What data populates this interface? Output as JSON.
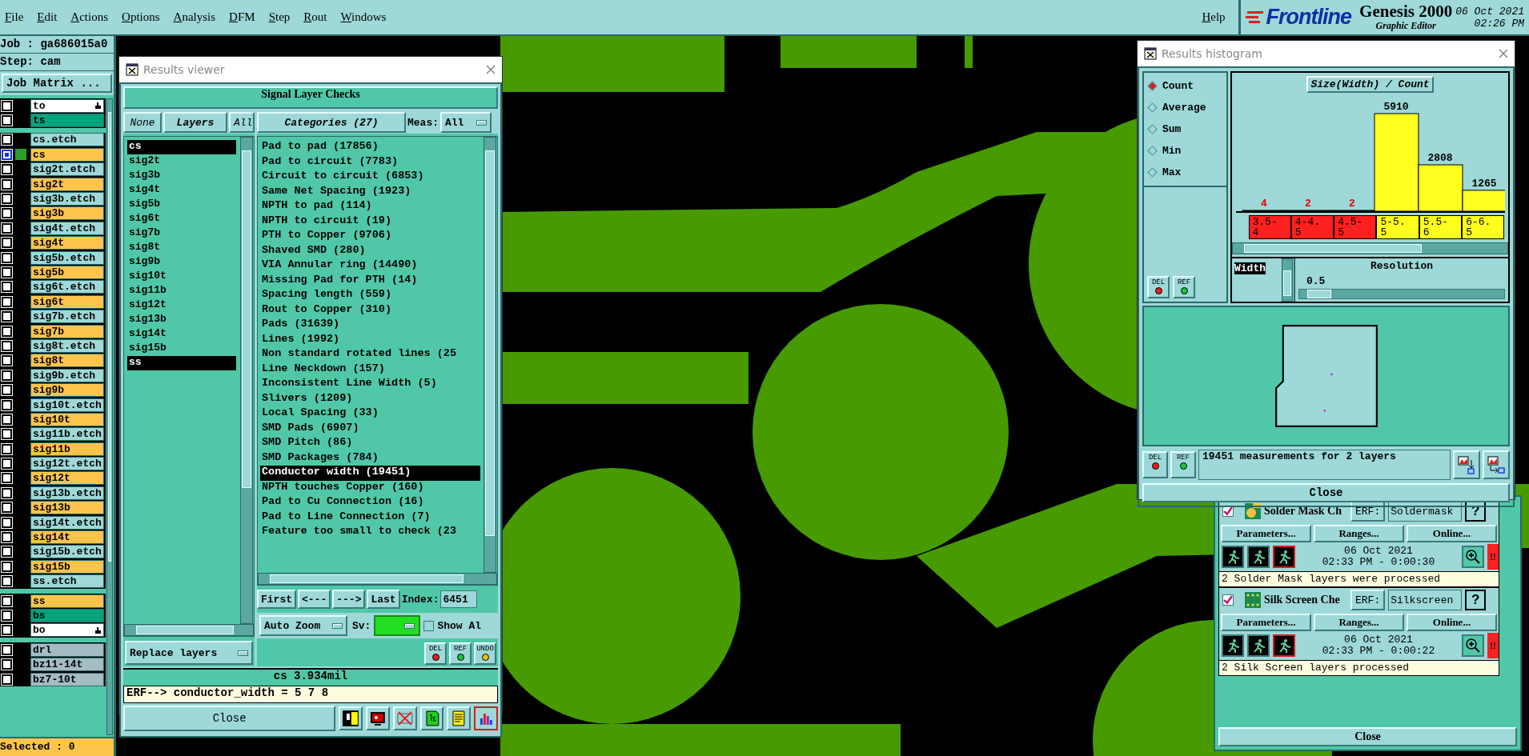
{
  "menu_bar": {
    "items": [
      "File",
      "Edit",
      "Actions",
      "Options",
      "Analysis",
      "DFM",
      "Step",
      "Rout",
      "Windows"
    ],
    "help": "Help",
    "logo": "Frontline",
    "product": "Genesis 2000",
    "subtitle": "Graphic Editor",
    "date": "06 Oct 2021",
    "time": "02:26 PM"
  },
  "job_panel": {
    "job": "Job : ga686015a0",
    "step": "Step: cam",
    "matrix_button": "Job Matrix ...",
    "selected_count": "Selected : 0",
    "layer_groups": [
      {
        "layers": [
          {
            "name": "to",
            "color": "#ffffff",
            "kind": "hand",
            "selected": false
          },
          {
            "name": "ts",
            "color": "#00a47c",
            "kind": "plain",
            "selected": false
          }
        ]
      },
      {
        "layers": [
          {
            "name": "cs.etch",
            "color": "#9ed8d8",
            "kind": "plain",
            "selected": false
          },
          {
            "name": "cs",
            "color": "#ffc44c",
            "kind": "plain",
            "selected": true
          },
          {
            "name": "sig2t.etch",
            "color": "#9ed8d8",
            "kind": "plain",
            "selected": false
          },
          {
            "name": "sig2t",
            "color": "#ffc44c",
            "kind": "plain",
            "selected": false
          },
          {
            "name": "sig3b.etch",
            "color": "#9ed8d8",
            "kind": "plain",
            "selected": false
          },
          {
            "name": "sig3b",
            "color": "#ffc44c",
            "kind": "plain",
            "selected": false
          },
          {
            "name": "sig4t.etch",
            "color": "#9ed8d8",
            "kind": "plain",
            "selected": false
          },
          {
            "name": "sig4t",
            "color": "#ffc44c",
            "kind": "plain",
            "selected": false
          },
          {
            "name": "sig5b.etch",
            "color": "#9ed8d8",
            "kind": "plain",
            "selected": false
          },
          {
            "name": "sig5b",
            "color": "#ffc44c",
            "kind": "plain",
            "selected": false
          },
          {
            "name": "sig6t.etch",
            "color": "#9ed8d8",
            "kind": "plain",
            "selected": false
          },
          {
            "name": "sig6t",
            "color": "#ffc44c",
            "kind": "plain",
            "selected": false
          },
          {
            "name": "sig7b.etch",
            "color": "#9ed8d8",
            "kind": "plain",
            "selected": false
          },
          {
            "name": "sig7b",
            "color": "#ffc44c",
            "kind": "plain",
            "selected": false
          },
          {
            "name": "sig8t.etch",
            "color": "#9ed8d8",
            "kind": "plain",
            "selected": false
          },
          {
            "name": "sig8t",
            "color": "#ffc44c",
            "kind": "plain",
            "selected": false
          },
          {
            "name": "sig9b.etch",
            "color": "#9ed8d8",
            "kind": "plain",
            "selected": false
          },
          {
            "name": "sig9b",
            "color": "#ffc44c",
            "kind": "plain",
            "selected": false
          },
          {
            "name": "sig10t.etch",
            "color": "#9ed8d8",
            "kind": "plain",
            "selected": false
          },
          {
            "name": "sig10t",
            "color": "#ffc44c",
            "kind": "plain",
            "selected": false
          },
          {
            "name": "sig11b.etch",
            "color": "#9ed8d8",
            "kind": "plain",
            "selected": false
          },
          {
            "name": "sig11b",
            "color": "#ffc44c",
            "kind": "plain",
            "selected": false
          },
          {
            "name": "sig12t.etch",
            "color": "#9ed8d8",
            "kind": "plain",
            "selected": false
          },
          {
            "name": "sig12t",
            "color": "#ffc44c",
            "kind": "plain",
            "selected": false
          },
          {
            "name": "sig13b.etch",
            "color": "#9ed8d8",
            "kind": "plain",
            "selected": false
          },
          {
            "name": "sig13b",
            "color": "#ffc44c",
            "kind": "plain",
            "selected": false
          },
          {
            "name": "sig14t.etch",
            "color": "#9ed8d8",
            "kind": "plain",
            "selected": false
          },
          {
            "name": "sig14t",
            "color": "#ffc44c",
            "kind": "plain",
            "selected": false
          },
          {
            "name": "sig15b.etch",
            "color": "#9ed8d8",
            "kind": "plain",
            "selected": false
          },
          {
            "name": "sig15b",
            "color": "#ffc44c",
            "kind": "plain",
            "selected": false
          },
          {
            "name": "ss.etch",
            "color": "#9ed8d8",
            "kind": "plain",
            "selected": false
          }
        ]
      },
      {
        "layers": [
          {
            "name": "ss",
            "color": "#ffc44c",
            "kind": "plain",
            "selected": false
          },
          {
            "name": "bs",
            "color": "#00a47c",
            "kind": "plain",
            "selected": false
          },
          {
            "name": "bo",
            "color": "#ffffff",
            "kind": "hand",
            "selected": false
          }
        ]
      },
      {
        "layers": [
          {
            "name": "drl",
            "color": "#a4bcc4",
            "kind": "plain",
            "selected": false
          },
          {
            "name": "bz11-14t",
            "color": "#a4bcc4",
            "kind": "plain",
            "selected": false
          },
          {
            "name": "bz7-10t",
            "color": "#a4bcc4",
            "kind": "plain",
            "selected": false
          }
        ]
      }
    ]
  },
  "results_viewer": {
    "title": "Results viewer",
    "header": "Signal Layer Checks",
    "none_button": "None",
    "layers_button": "Layers",
    "all_button": "All",
    "layers": [
      {
        "name": "cs",
        "selected": true
      },
      {
        "name": "sig2t",
        "selected": false
      },
      {
        "name": "sig3b",
        "selected": false
      },
      {
        "name": "sig4t",
        "selected": false
      },
      {
        "name": "sig5b",
        "selected": false
      },
      {
        "name": "sig6t",
        "selected": false
      },
      {
        "name": "sig7b",
        "selected": false
      },
      {
        "name": "sig8t",
        "selected": false
      },
      {
        "name": "sig9b",
        "selected": false
      },
      {
        "name": "sig10t",
        "selected": false
      },
      {
        "name": "sig11b",
        "selected": false
      },
      {
        "name": "sig12t",
        "selected": false
      },
      {
        "name": "sig13b",
        "selected": false
      },
      {
        "name": "sig14t",
        "selected": false
      },
      {
        "name": "sig15b",
        "selected": false
      },
      {
        "name": "ss",
        "selected": true
      }
    ],
    "layer_mode": "Replace layers",
    "categories_button": "Categories (27)",
    "meas_label": "Meas:",
    "meas_value": "All",
    "categories": [
      {
        "label": "Pad to pad (17856)",
        "selected": false
      },
      {
        "label": "Pad to circuit (7783)",
        "selected": false
      },
      {
        "label": "Circuit to circuit (6853)",
        "selected": false
      },
      {
        "label": "Same Net Spacing (1923)",
        "selected": false
      },
      {
        "label": "NPTH to pad (114)",
        "selected": false
      },
      {
        "label": "NPTH to circuit (19)",
        "selected": false
      },
      {
        "label": "PTH to Copper (9706)",
        "selected": false
      },
      {
        "label": "Shaved SMD (280)",
        "selected": false
      },
      {
        "label": "VIA Annular ring (14490)",
        "selected": false
      },
      {
        "label": "Missing Pad for PTH (14)",
        "selected": false
      },
      {
        "label": "Spacing length (559)",
        "selected": false
      },
      {
        "label": "Rout to Copper (310)",
        "selected": false
      },
      {
        "label": "Pads (31639)",
        "selected": false
      },
      {
        "label": "Lines (1992)",
        "selected": false
      },
      {
        "label": "Non standard rotated lines (25",
        "selected": false
      },
      {
        "label": "Line Neckdown (157)",
        "selected": false
      },
      {
        "label": "Inconsistent Line Width (5)",
        "selected": false
      },
      {
        "label": "Slivers (1209)",
        "selected": false
      },
      {
        "label": "Local Spacing (33)",
        "selected": false
      },
      {
        "label": "SMD Pads (6907)",
        "selected": false
      },
      {
        "label": "SMD Pitch (86)",
        "selected": false
      },
      {
        "label": "SMD Packages (784)",
        "selected": false
      },
      {
        "label": "Conductor width (19451)",
        "selected": true
      },
      {
        "label": "NPTH touches Copper (160)",
        "selected": false
      },
      {
        "label": "Pad to Cu Connection (16)",
        "selected": false
      },
      {
        "label": "Pad to Line Connection (7)",
        "selected": false
      },
      {
        "label": "Feature too small to check (23",
        "selected": false
      }
    ],
    "nav": [
      "First",
      "<---",
      "--->",
      "Last"
    ],
    "index_label": "Index:",
    "index_value": "6451",
    "zoom_mode": "Auto Zoom",
    "sv_label": "Sv:",
    "show_all": {
      "label": "Show Al",
      "checked": false
    },
    "tools": [
      "DEL",
      "REF",
      "UNDO"
    ],
    "status": "cs 3.934mil",
    "erf_line": "ERF--> conductor_width = 5 7 8",
    "close": "Close"
  },
  "histogram": {
    "title": "Results histogram",
    "modes": [
      {
        "label": "Count",
        "selected": true
      },
      {
        "label": "Average",
        "selected": false
      },
      {
        "label": "Sum",
        "selected": false
      },
      {
        "label": "Min",
        "selected": false
      },
      {
        "label": "Max",
        "selected": false
      }
    ],
    "side_tools": [
      "DEL",
      "REF"
    ],
    "chart_data": {
      "type": "bar",
      "title": "Size(Width) / Count",
      "categories": [
        "3.5-4",
        "4-4.5",
        "4.5-5",
        "5-5.5",
        "5.5-6",
        "6-6.5"
      ],
      "values": [
        4,
        2,
        2,
        5910,
        2808,
        1265
      ],
      "data_labels": true
    },
    "bins": [
      {
        "flagged": true
      },
      {
        "flagged": true
      },
      {
        "flagged": true
      },
      {
        "flagged": false
      },
      {
        "flagged": false
      },
      {
        "flagged": false
      }
    ],
    "field": "Width",
    "resolution_label": "Resolution",
    "resolution_value": "0.5",
    "resolution": {
      "level": 0.04
    },
    "bottom_tools": [
      "DEL",
      "REF"
    ],
    "summary": "19451 measurements for 2 layers",
    "close": "Close"
  },
  "checks_panel": {
    "checks": [
      {
        "kind": "solder_mask",
        "name": "Solder Mask Ch",
        "checked": true,
        "erf_label": "ERF:",
        "erf_value": "Soldermask",
        "help": "?",
        "buttons": [
          "Parameters...",
          "Ranges...",
          "Online..."
        ],
        "date": "06 Oct 2021",
        "time_line": "02:33 PM - 0:00:30",
        "alert": "!!",
        "message": "2 Solder Mask layers were processed"
      },
      {
        "kind": "silk_screen",
        "name": "Silk Screen Che",
        "checked": true,
        "erf_label": "ERF:",
        "erf_value": "Silkscreen",
        "help": "?",
        "buttons": [
          "Parameters...",
          "Ranges...",
          "Online..."
        ],
        "date": "06 Oct 2021",
        "time_line": "02:33 PM - 0:00:22",
        "alert": "!!",
        "message": "2 Silk Screen layers processed"
      }
    ],
    "close": "Close"
  }
}
